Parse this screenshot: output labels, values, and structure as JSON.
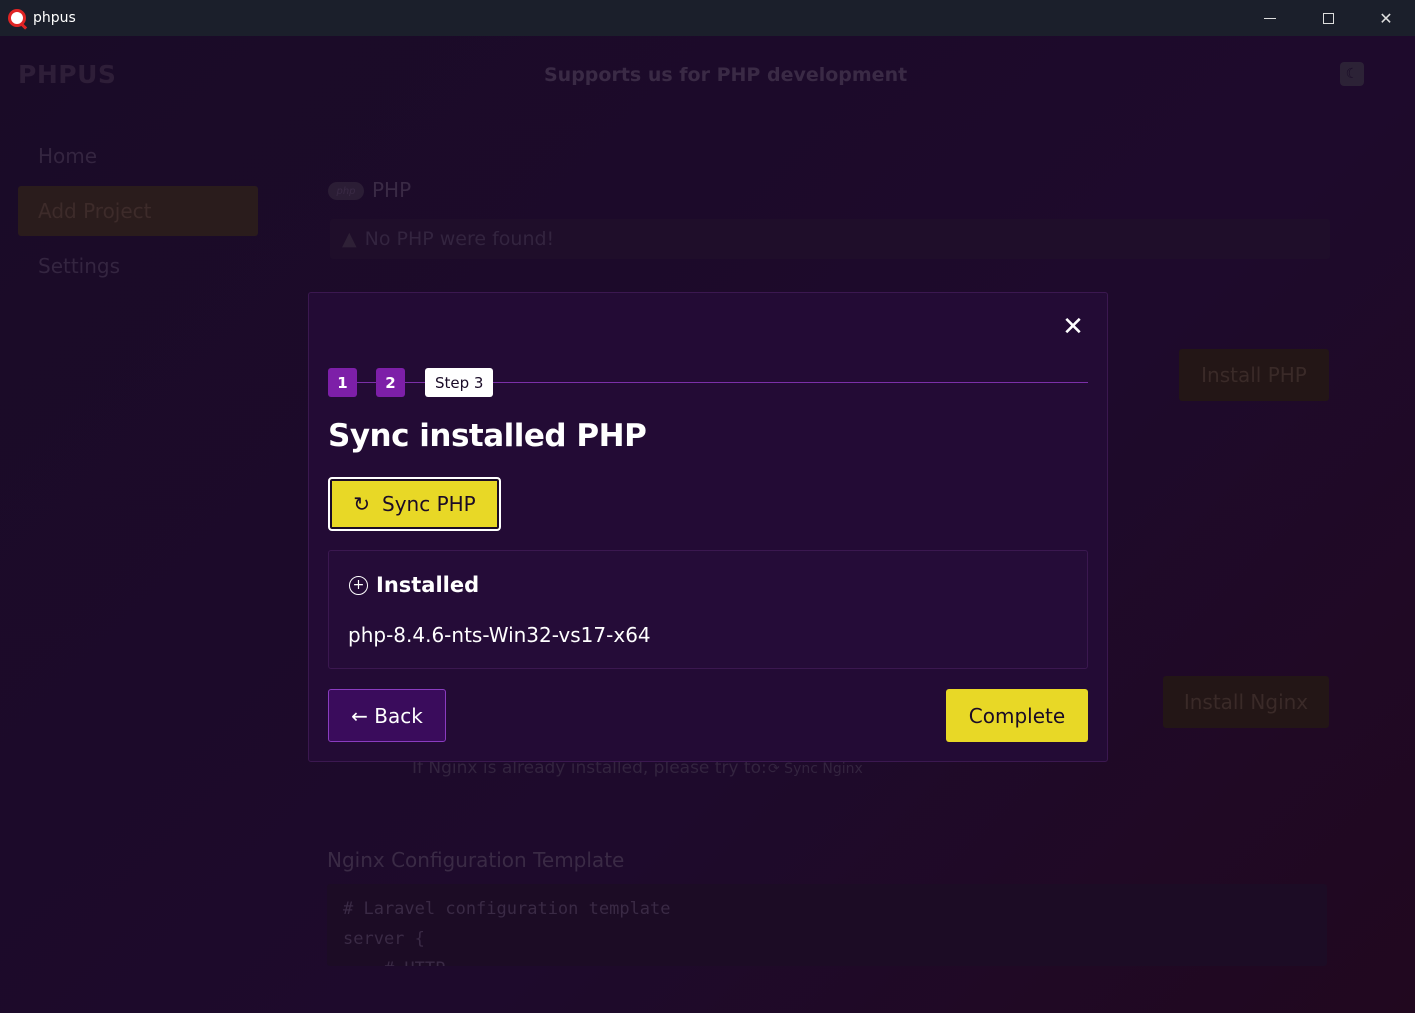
{
  "window": {
    "title": "phpus",
    "minimize_glyph": "",
    "close_glyph": "✕"
  },
  "header": {
    "brand": "PHPUS",
    "tagline": "Supports us for PHP development",
    "theme_icon": "☾"
  },
  "nav": {
    "items": [
      {
        "label": "Home"
      },
      {
        "label": "Add Project"
      },
      {
        "label": "Settings"
      }
    ]
  },
  "background": {
    "php_badge": "php",
    "php_title": "PHP",
    "php_alert": "No PHP were found!",
    "install_php": "Install PHP",
    "install_nginx": "Install Nginx",
    "nginx_hint": "If Nginx is already installed, please try to:",
    "sync_nginx": "⟳ Sync Nginx",
    "nginx_template_title": "Nginx Configuration Template",
    "nginx_template_code": "# Laravel configuration template\nserver {\n    # HTTP"
  },
  "modal": {
    "close_glyph": "✕",
    "steps": [
      "1",
      "2",
      "Step 3"
    ],
    "title": "Sync installed PHP",
    "sync_button": "Sync PHP",
    "installed_heading": "Installed",
    "installed_items": [
      "php-8.4.6-nts-Win32-vs17-x64"
    ],
    "back_button": "← Back",
    "complete_button": "Complete"
  },
  "colors": {
    "accent_yellow": "#e8d826",
    "step_purple": "#7d1fa8",
    "modal_bg": "#230b35"
  }
}
